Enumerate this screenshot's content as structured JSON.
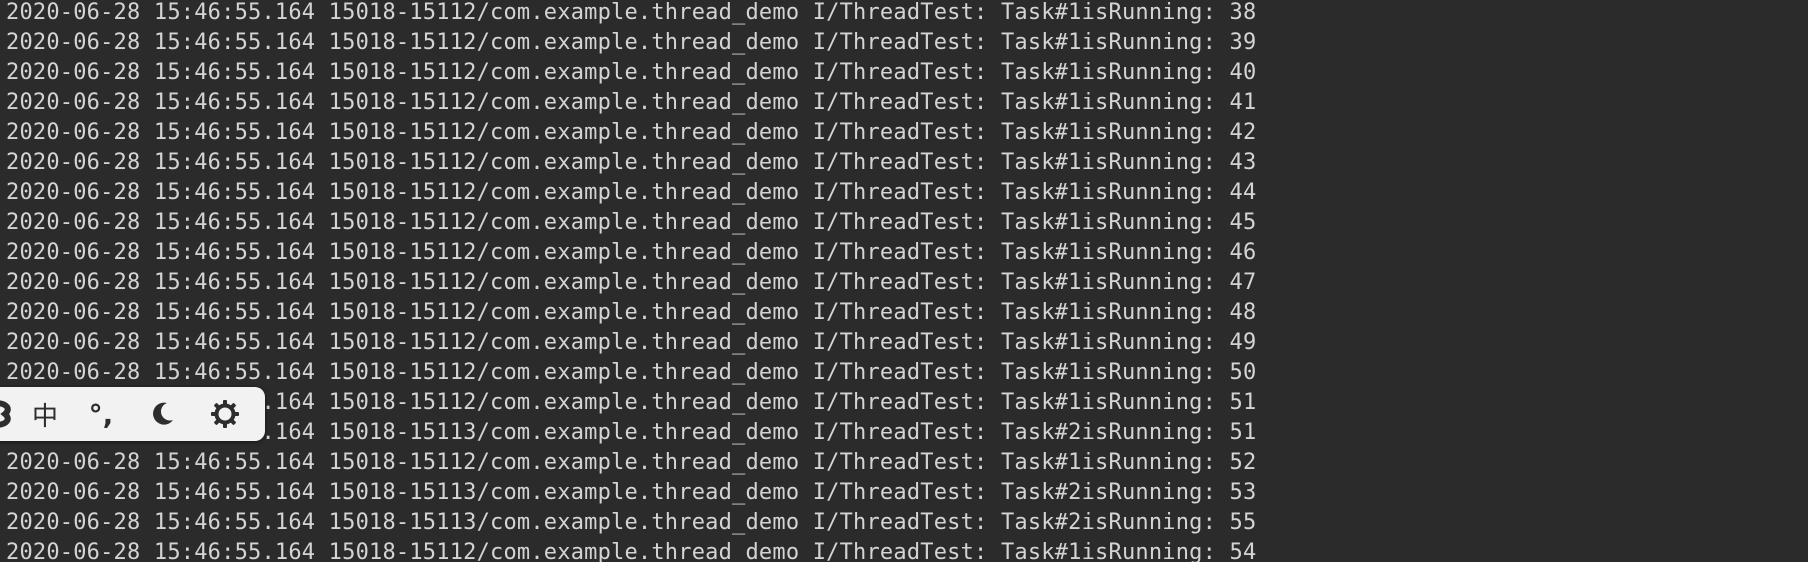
{
  "console": {
    "lines": [
      "2020-06-28 15:46:55.164 15018-15112/com.example.thread_demo I/ThreadTest: Task#1isRunning: 38",
      "2020-06-28 15:46:55.164 15018-15112/com.example.thread_demo I/ThreadTest: Task#1isRunning: 39",
      "2020-06-28 15:46:55.164 15018-15112/com.example.thread_demo I/ThreadTest: Task#1isRunning: 40",
      "2020-06-28 15:46:55.164 15018-15112/com.example.thread_demo I/ThreadTest: Task#1isRunning: 41",
      "2020-06-28 15:46:55.164 15018-15112/com.example.thread_demo I/ThreadTest: Task#1isRunning: 42",
      "2020-06-28 15:46:55.164 15018-15112/com.example.thread_demo I/ThreadTest: Task#1isRunning: 43",
      "2020-06-28 15:46:55.164 15018-15112/com.example.thread_demo I/ThreadTest: Task#1isRunning: 44",
      "2020-06-28 15:46:55.164 15018-15112/com.example.thread_demo I/ThreadTest: Task#1isRunning: 45",
      "2020-06-28 15:46:55.164 15018-15112/com.example.thread_demo I/ThreadTest: Task#1isRunning: 46",
      "2020-06-28 15:46:55.164 15018-15112/com.example.thread_demo I/ThreadTest: Task#1isRunning: 47",
      "2020-06-28 15:46:55.164 15018-15112/com.example.thread_demo I/ThreadTest: Task#1isRunning: 48",
      "2020-06-28 15:46:55.164 15018-15112/com.example.thread_demo I/ThreadTest: Task#1isRunning: 49",
      "2020-06-28 15:46:55.164 15018-15112/com.example.thread_demo I/ThreadTest: Task#1isRunning: 50",
      "2020-06-28 15:46:55.164 15018-15112/com.example.thread_demo I/ThreadTest: Task#1isRunning: 51",
      "2020-06-28 15:46:55.164 15018-15113/com.example.thread_demo I/ThreadTest: Task#2isRunning: 51",
      "2020-06-28 15:46:55.164 15018-15112/com.example.thread_demo I/ThreadTest: Task#1isRunning: 52",
      "2020-06-28 15:46:55.164 15018-15113/com.example.thread_demo I/ThreadTest: Task#2isRunning: 53",
      "2020-06-28 15:46:55.164 15018-15113/com.example.thread_demo I/ThreadTest: Task#2isRunning: 55",
      "2020-06-28 15:46:55.164 15018-15112/com.example.thread_demo I/ThreadTest: Task#1isRunning: 54"
    ],
    "text_color": "#d4d4d4",
    "background_color": "#2b2b2b"
  },
  "ime_toolbar": {
    "background_color": "#f2f2f2",
    "items": [
      {
        "icon": "ime-logo-icon"
      },
      {
        "label": "中",
        "icon": "chinese-mode-icon"
      },
      {
        "label": "°,",
        "icon": "punctuation-icon"
      },
      {
        "icon": "moon-icon"
      },
      {
        "icon": "gear-icon"
      }
    ]
  }
}
